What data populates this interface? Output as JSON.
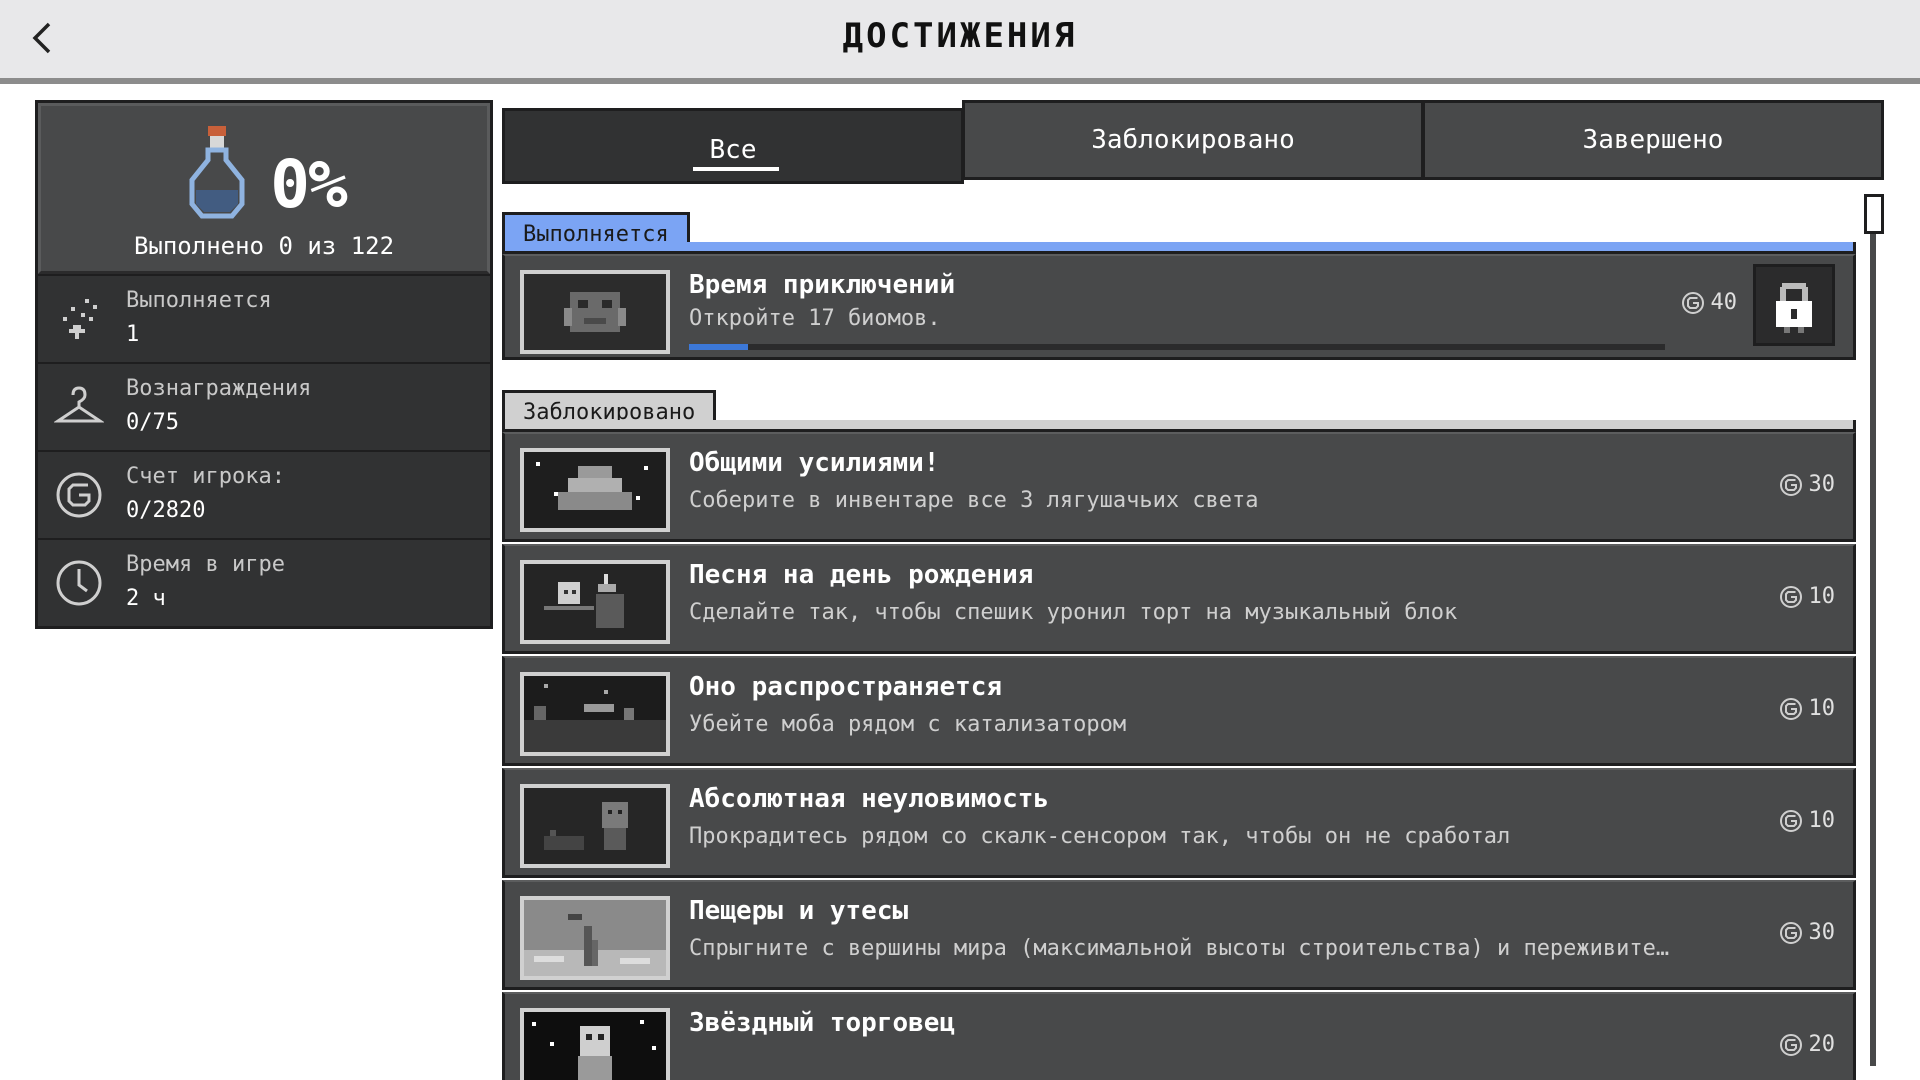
{
  "header": {
    "title": "ДОСТИЖЕНИЯ"
  },
  "stats": {
    "percent": "0%",
    "completed_text": "Выполнено 0 из 122",
    "rows": [
      {
        "label": "Выполняется",
        "value": "1",
        "icon": "sparkle-icon"
      },
      {
        "label": "Вознаграждения",
        "value": "0/75",
        "icon": "hanger-icon"
      },
      {
        "label": "Счет игрока:",
        "value": "0/2820",
        "icon": "gamerscore-icon"
      },
      {
        "label": "Время в игре",
        "value": "2 ч",
        "icon": "clock-icon"
      }
    ]
  },
  "tabs": [
    {
      "label": "Все",
      "active": true
    },
    {
      "label": "Заблокировано",
      "active": false
    },
    {
      "label": "Завершено",
      "active": false
    }
  ],
  "sections": {
    "in_progress": {
      "label": "Выполняется",
      "color": "#7ba4f4",
      "items": [
        {
          "title": "Время приключений",
          "desc": "Откройте 17 биомов.",
          "score": "40",
          "progress": 0.06
        }
      ]
    },
    "locked": {
      "label": "Заблокировано",
      "color": "#d0d0d0",
      "items": [
        {
          "title": "Общими усилиями!",
          "desc": "Соберите в инвентаре все 3 лягушачьих света",
          "score": "30"
        },
        {
          "title": "Песня на день рождения",
          "desc": "Сделайте так, чтобы спешик уронил торт на музыкальный блок",
          "score": "10"
        },
        {
          "title": "Оно распространяется",
          "desc": "Убейте моба рядом с катализатором",
          "score": "10"
        },
        {
          "title": "Абсолютная неуловимость",
          "desc": "Прокрадитесь рядом со скалк-сенсором так, чтобы он не сработал",
          "score": "10"
        },
        {
          "title": "Пещеры и утесы",
          "desc": "Спрыгните с вершины мира (максимальной высоты строительства) и переживите…",
          "score": "30"
        },
        {
          "title": "Звёздный торговец",
          "desc": "",
          "score": "20"
        }
      ]
    }
  }
}
